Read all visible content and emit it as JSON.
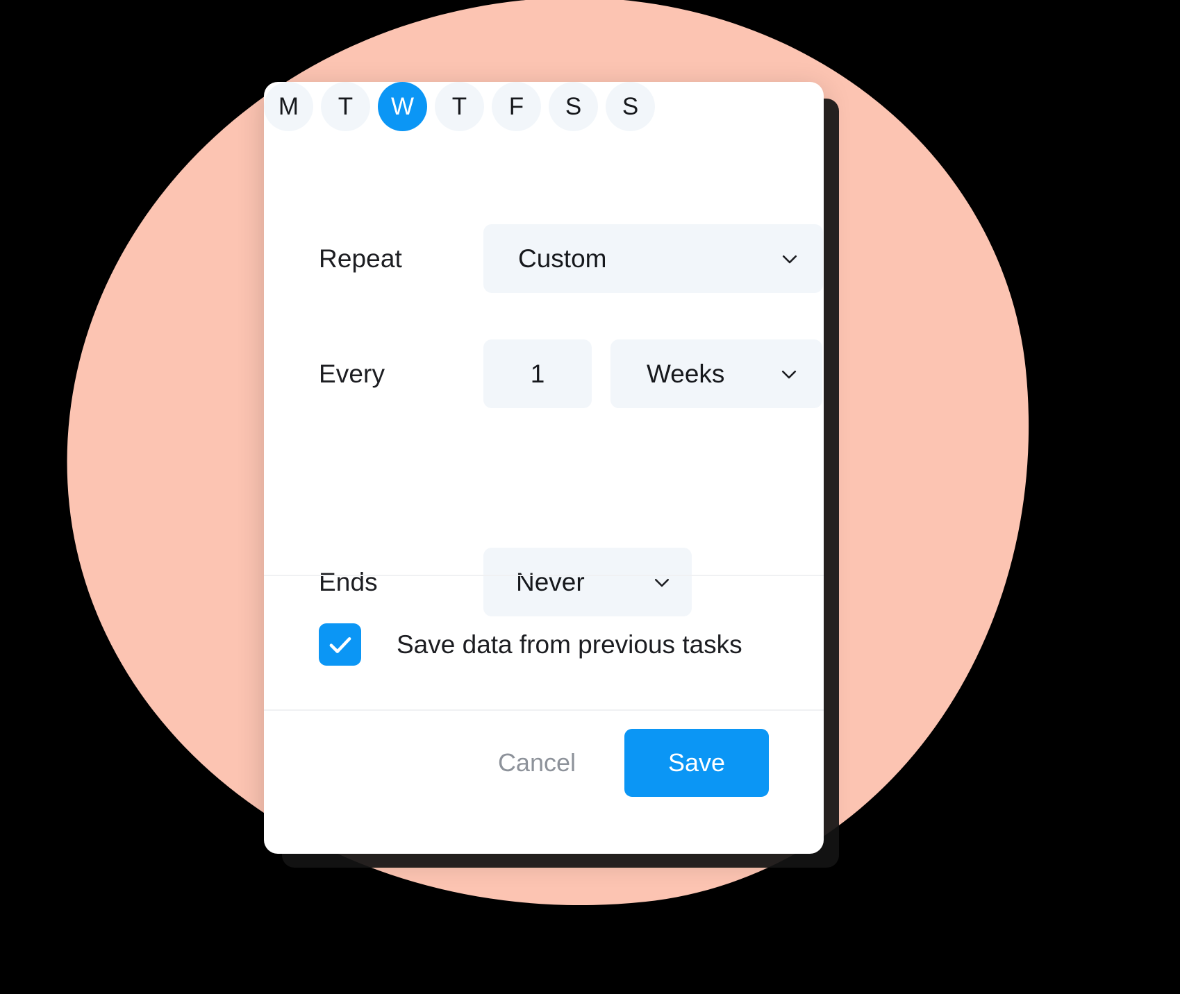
{
  "theme": {
    "background": "#000000",
    "blob_color": "#FCC4B2",
    "card_background": "#ffffff",
    "field_background": "#f2f6fa",
    "accent": "#0b96f5",
    "text_primary": "#1c1d21",
    "text_muted": "#8d929a",
    "divider": "#f0f1f3"
  },
  "dialog": {
    "repeat": {
      "label": "Repeat",
      "value": "Custom",
      "chevron_icon": "chevron-down-icon"
    },
    "every": {
      "label": "Every",
      "interval_value": "1",
      "unit_value": "Weeks",
      "chevron_icon": "chevron-down-icon"
    },
    "days": [
      {
        "letter": "M",
        "name": "monday",
        "selected": false
      },
      {
        "letter": "T",
        "name": "tuesday",
        "selected": false
      },
      {
        "letter": "W",
        "name": "wednesday",
        "selected": true
      },
      {
        "letter": "T",
        "name": "thursday",
        "selected": false
      },
      {
        "letter": "F",
        "name": "friday",
        "selected": false
      },
      {
        "letter": "S",
        "name": "saturday",
        "selected": false
      },
      {
        "letter": "S",
        "name": "sunday",
        "selected": false
      }
    ],
    "ends": {
      "label": "Ends",
      "value": "Never",
      "chevron_icon": "chevron-down-icon"
    },
    "save_previous": {
      "label": "Save data from previous tasks",
      "checked": true,
      "check_icon": "check-icon"
    },
    "actions": {
      "cancel_label": "Cancel",
      "save_label": "Save"
    }
  }
}
